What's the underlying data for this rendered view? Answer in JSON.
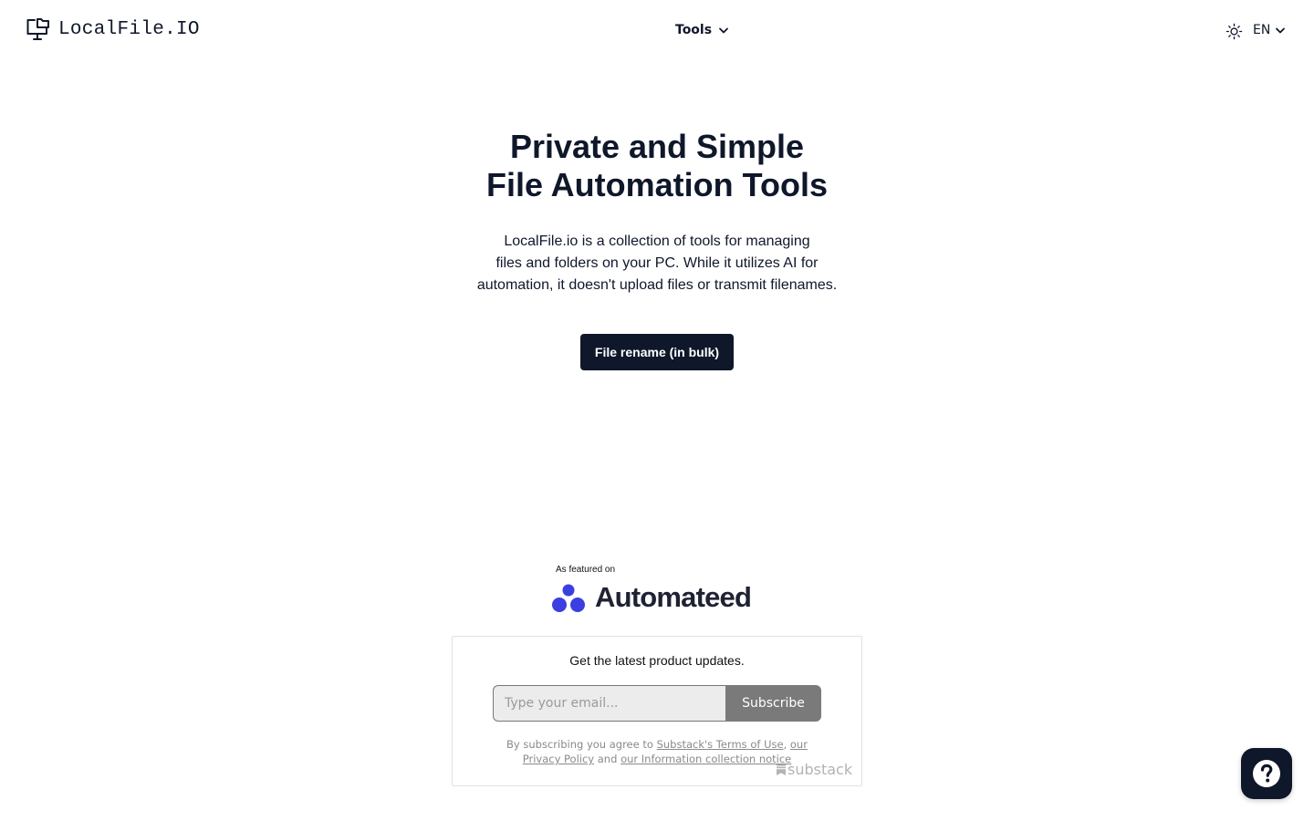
{
  "header": {
    "brand": "LocalFile.IO",
    "brand_icon": "monitor-folder-icon",
    "tools_label": "Tools",
    "language": "EN",
    "theme_icon": "sun-icon"
  },
  "hero": {
    "title_line1": "Private and Simple",
    "title_line2": "File Automation Tools",
    "desc_line1": "LocalFile.io is a collection of tools for managing",
    "desc_line2": "files and folders on your PC. While it utilizes AI for",
    "desc_line3": "automation, it doesn't upload files or transmit filenames.",
    "cta_label": "File rename (in bulk)"
  },
  "featured": {
    "label": "As featured on",
    "name": "Automateed",
    "icon": "automateed-logo-icon",
    "brand_color": "#3b3fe0"
  },
  "newsletter": {
    "heading": "Get the latest product updates.",
    "email_placeholder": "Type your email...",
    "subscribe_label": "Subscribe",
    "legal_prefix": "By subscribing you agree to ",
    "terms_link": "Substack's Terms of Use",
    "comma": ", ",
    "privacy_link": "our Privacy Policy",
    "and": " and ",
    "info_link": "our Information collection notice",
    "powered_by": "substack"
  },
  "help": {
    "icon": "question-mark-icon"
  },
  "colors": {
    "primary": "#0f172a",
    "subscribe_button": "#7a7a7a",
    "background": "#ffffff"
  }
}
